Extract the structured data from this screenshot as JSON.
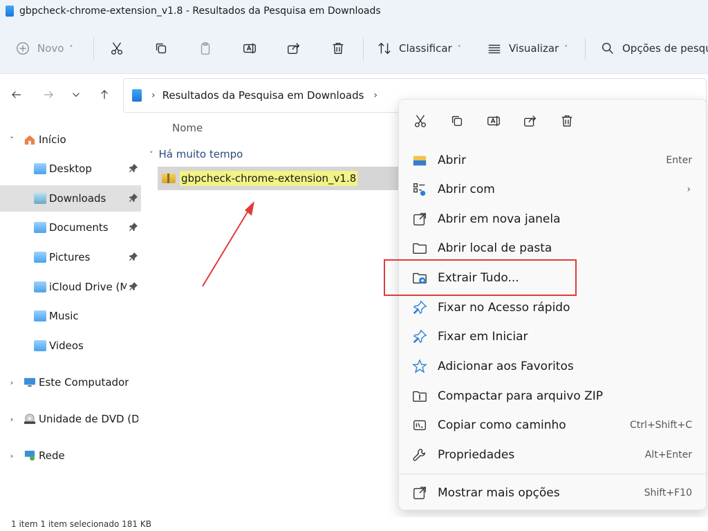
{
  "window": {
    "title": "gbpcheck-chrome-extension_v1.8 - Resultados da Pesquisa em Downloads"
  },
  "toolbar": {
    "new_label": "Novo",
    "sort_label": "Classificar",
    "view_label": "Visualizar",
    "search_options_label": "Opções de pesquisa"
  },
  "address": {
    "crumb": "Resultados da Pesquisa em Downloads"
  },
  "sidebar": {
    "items": [
      {
        "label": "Início"
      },
      {
        "label": "Desktop"
      },
      {
        "label": "Downloads"
      },
      {
        "label": "Documents"
      },
      {
        "label": "Pictures"
      },
      {
        "label": "iCloud Drive (Mac)"
      },
      {
        "label": "Music"
      },
      {
        "label": "Videos"
      },
      {
        "label": "Este Computador"
      },
      {
        "label": "Unidade de DVD (D:)"
      },
      {
        "label": "Rede"
      }
    ]
  },
  "content": {
    "column_name": "Nome",
    "group_header": "Há muito tempo",
    "file_name": "gbpcheck-chrome-extension_v1.8"
  },
  "context_menu": {
    "items": [
      {
        "label": "Abrir",
        "shortcut": "Enter"
      },
      {
        "label": "Abrir com",
        "shortcut": ""
      },
      {
        "label": "Abrir em nova janela",
        "shortcut": ""
      },
      {
        "label": "Abrir local de pasta",
        "shortcut": ""
      },
      {
        "label": "Extrair Tudo...",
        "shortcut": ""
      },
      {
        "label": "Fixar no Acesso rápido",
        "shortcut": ""
      },
      {
        "label": "Fixar em Iniciar",
        "shortcut": ""
      },
      {
        "label": "Adicionar aos Favoritos",
        "shortcut": ""
      },
      {
        "label": "Compactar para arquivo ZIP",
        "shortcut": ""
      },
      {
        "label": "Copiar como caminho",
        "shortcut": "Ctrl+Shift+C"
      },
      {
        "label": "Propriedades",
        "shortcut": "Alt+Enter"
      },
      {
        "label": "Mostrar mais opções",
        "shortcut": "Shift+F10"
      }
    ]
  },
  "status": {
    "text": "1 item    1 item selecionado  181 KB"
  },
  "colors": {
    "highlight_box": "#e23a3a",
    "arrow": "#e23a3a",
    "selected_row": "#d6d6d6"
  }
}
